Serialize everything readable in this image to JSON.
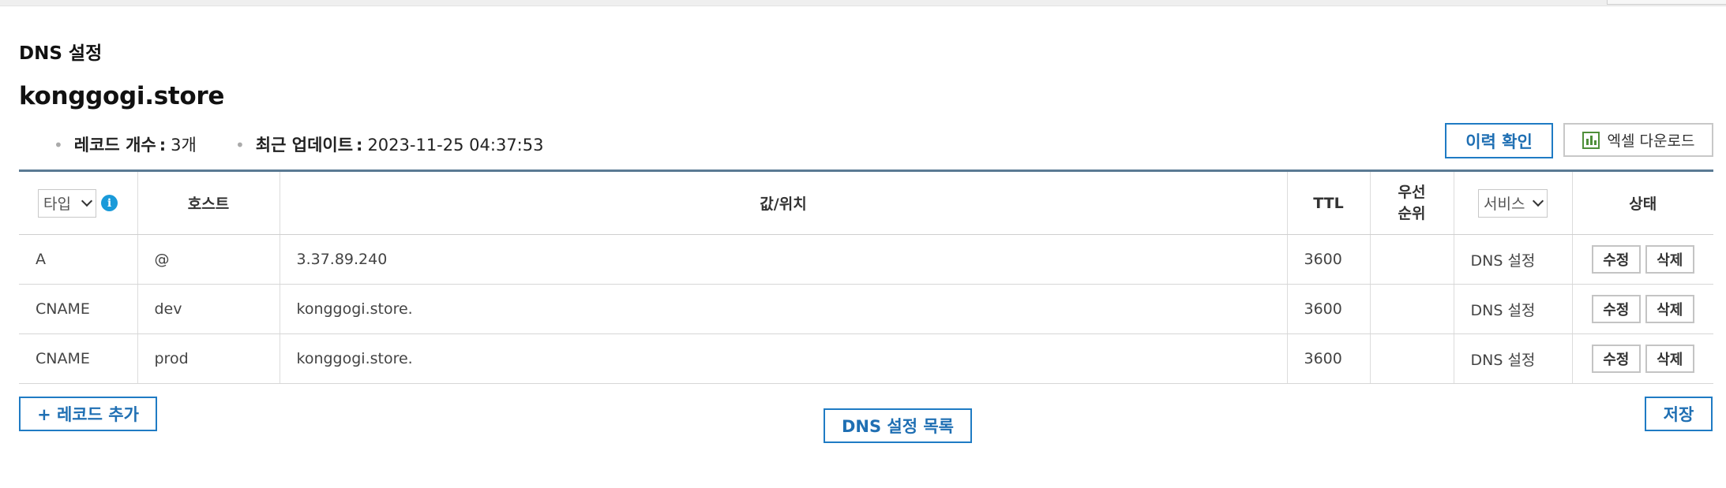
{
  "page": {
    "section_title": "DNS 설정",
    "domain": "konggogi.store",
    "record_count_label": "레코드 개수",
    "record_count_value": "3개",
    "updated_label": "최근 업데이트",
    "updated_value": "2023-11-25 04:37:53"
  },
  "actions": {
    "history_label": "이력 확인",
    "excel_label": "엑셀 다운로드",
    "add_record_label": "+ 레코드 추가",
    "dns_list_label": "DNS 설정 목록",
    "save_label": "저장"
  },
  "table": {
    "columns": {
      "type_select": "타입",
      "host": "호스트",
      "value": "값/위치",
      "ttl": "TTL",
      "priority": "우선\n순위",
      "service_select": "서비스",
      "status": "상태"
    },
    "row_edit_label": "수정",
    "row_delete_label": "삭제",
    "rows": [
      {
        "type": "A",
        "host": "@",
        "value": "3.37.89.240",
        "ttl": "3600",
        "priority": "",
        "service": "DNS 설정"
      },
      {
        "type": "CNAME",
        "host": "dev",
        "value": "konggogi.store.",
        "ttl": "3600",
        "priority": "",
        "service": "DNS 설정"
      },
      {
        "type": "CNAME",
        "host": "prod",
        "value": "konggogi.store.",
        "ttl": "3600",
        "priority": "",
        "service": "DNS 설정"
      }
    ]
  },
  "colors": {
    "accent": "#1f7bc4",
    "header_rule": "#5a7a93",
    "info_icon": "#1a9ad9",
    "excel_icon": "#4f8f3a"
  }
}
